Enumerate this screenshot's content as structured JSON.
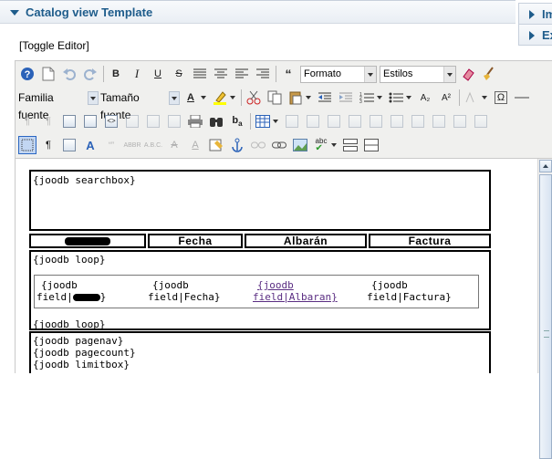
{
  "panel": {
    "title": "Catalog view Template"
  },
  "side_panels": [
    {
      "label": "Im"
    },
    {
      "label": "Ex"
    }
  ],
  "toggle_editor": "[Toggle Editor]",
  "toolbar": {
    "format_select": "Formato",
    "styles_select": "Estilos",
    "font_family_select": "Familia fuente",
    "font_size_select": "Tamaño fuente",
    "font_color_glyph": "A",
    "sup_label": "A²",
    "sub_label": "A₂"
  },
  "editor": {
    "searchbox": "{joodb searchbox}",
    "headers": [
      "Fecha",
      "Albarán",
      "Factura"
    ],
    "loop_start": "{joodb loop}",
    "fields": [
      {
        "line1": "{joodb",
        "line2": "field|",
        "suffix": "}"
      },
      {
        "line1": "{joodb",
        "line2": "field|Fecha}"
      },
      {
        "line1": "{joodb",
        "line2": "field|Albaran}"
      },
      {
        "line1": "{joodb",
        "line2": "field|Factura}"
      }
    ],
    "loop_end": "{joodb loop}",
    "footer": [
      "{joodb pagenav}",
      "{joodb pagecount}",
      "{joodb limitbox}"
    ]
  }
}
